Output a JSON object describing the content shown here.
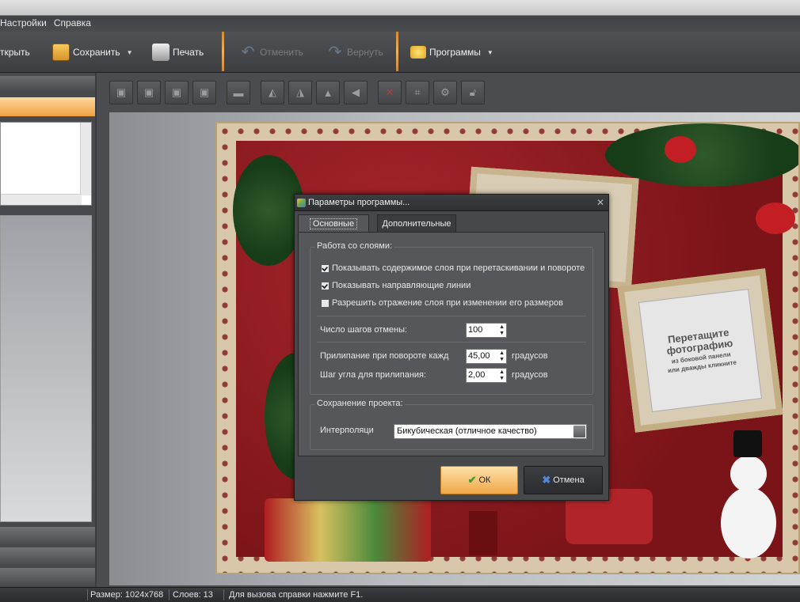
{
  "menu": {
    "items": [
      "Настройки",
      "Справка"
    ]
  },
  "toolbar": {
    "open_label": "ткрыть",
    "save_label": "Сохранить",
    "print_label": "Печать",
    "undo_label": "Отменить",
    "redo_label": "Вернуть",
    "programs_label": "Программы"
  },
  "canvas": {
    "placeholder_line1": "Перетащите",
    "placeholder_line2": "фотографию",
    "placeholder_line3": "из боковой панели",
    "placeholder_line4": "или дважды кликните"
  },
  "dialog": {
    "title": "Параметры программы...",
    "tabs": [
      "Основные",
      "Дополнительные"
    ],
    "layers_group": "Работа со слоями:",
    "checkboxes": [
      {
        "label": "Показывать содержимое слоя при перетаскивании и повороте",
        "checked": true
      },
      {
        "label": "Показывать направляющие линии",
        "checked": true
      },
      {
        "label": "Разрешить отражение слоя при изменении его размеров",
        "checked": false
      }
    ],
    "undo_steps_label": "Число шагов отмены:",
    "undo_steps_value": "100",
    "snap_rotate_label": "Прилипание при повороте кажд",
    "snap_rotate_value": "45,00",
    "snap_angle_label": "Шаг угла для прилипания:",
    "snap_angle_value": "2,00",
    "unit_label": "градусов",
    "save_group": "Сохранение проекта:",
    "interp_label": "Интерполяци",
    "interp_value": "Бикубическая (отличное качество)",
    "ok_label": "ОК",
    "cancel_label": "Отмена"
  },
  "status": {
    "size": "Размер: 1024x768",
    "layers": "Слоев: 13",
    "hint": "Для вызова справки нажмите F1."
  },
  "colors": {
    "accent_orange": "#f0a848",
    "card_red": "#8e1a1f",
    "dark_ui": "#46484b"
  }
}
